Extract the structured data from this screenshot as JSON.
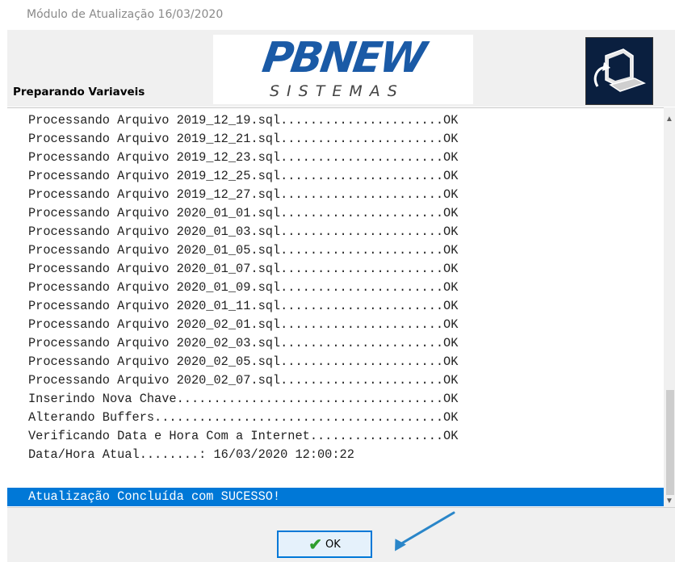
{
  "window": {
    "title": "Módulo de Atualização 16/03/2020"
  },
  "header": {
    "status_label": "Preparando Variaveis",
    "logo": {
      "main": "PBNEW",
      "sub": "SISTEMAS"
    }
  },
  "log": {
    "lines": [
      "Processando Arquivo 2019_12_19.sql......................OK",
      "Processando Arquivo 2019_12_21.sql......................OK",
      "Processando Arquivo 2019_12_23.sql......................OK",
      "Processando Arquivo 2019_12_25.sql......................OK",
      "Processando Arquivo 2019_12_27.sql......................OK",
      "Processando Arquivo 2020_01_01.sql......................OK",
      "Processando Arquivo 2020_01_03.sql......................OK",
      "Processando Arquivo 2020_01_05.sql......................OK",
      "Processando Arquivo 2020_01_07.sql......................OK",
      "Processando Arquivo 2020_01_09.sql......................OK",
      "Processando Arquivo 2020_01_11.sql......................OK",
      "Processando Arquivo 2020_02_01.sql......................OK",
      "Processando Arquivo 2020_02_03.sql......................OK",
      "Processando Arquivo 2020_02_05.sql......................OK",
      "Processando Arquivo 2020_02_07.sql......................OK",
      "Inserindo Nova Chave....................................OK",
      "Alterando Buffers.......................................OK",
      "Verificando Data e Hora Com a Internet..................OK",
      "Data/Hora Atual........: 16/03/2020 12:00:22"
    ],
    "success_message": "Atualização Concluída com SUCESSO!"
  },
  "footer": {
    "ok_label": "OK"
  },
  "colors": {
    "accent": "#0078d7",
    "logo_blue": "#1a5aa6",
    "check_green": "#2e9e2e"
  },
  "icons": {
    "ok_icon": "checkmark-icon",
    "app_icon": "computer-update-icon",
    "annotation": "arrow-annotation"
  }
}
